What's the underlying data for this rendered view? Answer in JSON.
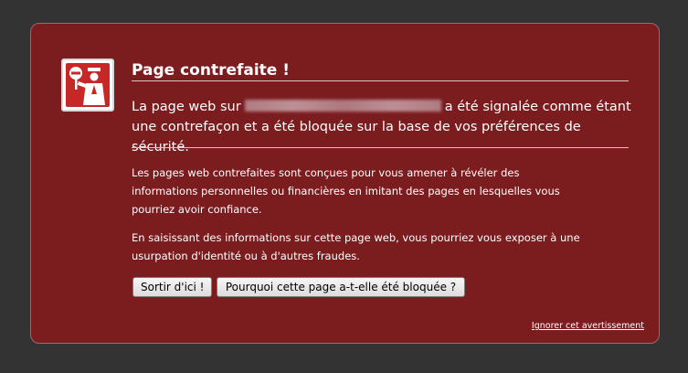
{
  "warning": {
    "title": "Page contrefaite !",
    "lead_before": "La page web sur",
    "lead_after": "a été signalée comme étant une contrefaçon et a été bloquée sur la base de vos préférences de sécurité.",
    "paragraph_1": "Les pages web contrefaites sont conçues pour vous amener à révéler des informations personnelles ou financières en imitant des pages en lesquelles vous pourriez avoir confiance.",
    "paragraph_2": "En saisissant des informations sur cette page web, vous pourriez vous exposer à une usurpation d'identité ou à d'autres fraudes."
  },
  "buttons": {
    "get_out": "Sortir d'ici !",
    "why_blocked": "Pourquoi cette page a-t-elle été bloquée ?"
  },
  "ignore_link": "Ignorer cet avertissement",
  "icons": {
    "badge": "police-officer-stop-icon"
  },
  "colors": {
    "page_background": "#333333",
    "panel_background": "#7b1c1f",
    "icon_red": "#c62828",
    "text": "#ffffff"
  }
}
